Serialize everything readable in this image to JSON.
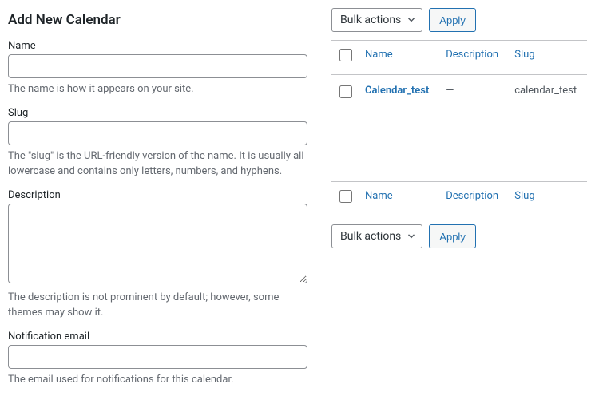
{
  "form": {
    "heading": "Add New Calendar",
    "name": {
      "label": "Name",
      "help": "The name is how it appears on your site."
    },
    "slug": {
      "label": "Slug",
      "help": "The \"slug\" is the URL-friendly version of the name. It is usually all lowercase and contains only letters, numbers, and hyphens."
    },
    "description": {
      "label": "Description",
      "help": "The description is not prominent by default; however, some themes may show it."
    },
    "notification_email": {
      "label": "Notification email",
      "help": "The email used for notifications for this calendar."
    }
  },
  "bulk": {
    "label": "Bulk actions",
    "apply": "Apply"
  },
  "table": {
    "columns": {
      "name": "Name",
      "description": "Description",
      "slug": "Slug"
    },
    "rows": [
      {
        "name": "Calendar_test",
        "description": "—",
        "slug": "calendar_test"
      }
    ]
  }
}
